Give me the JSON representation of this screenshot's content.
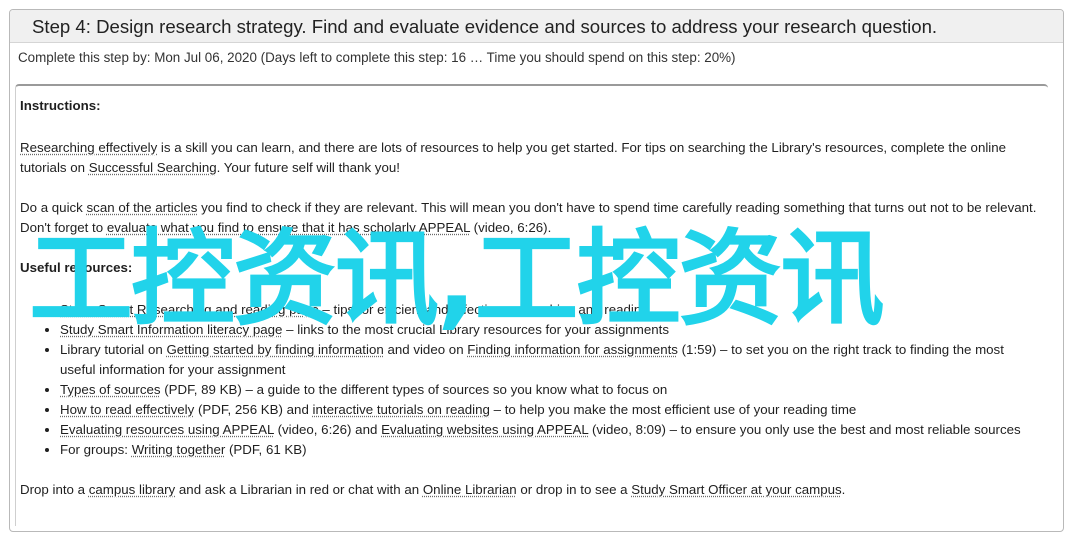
{
  "step": {
    "title": "Step 4: Design research strategy. Find and evaluate evidence and sources to address your research question.",
    "meta": "Complete this step by: Mon Jul 06, 2020 (Days left to complete this step: 16 … Time you should spend on this step: 20%)"
  },
  "instructions": {
    "heading": "Instructions:",
    "p1": {
      "link1": "Researching effectively",
      "text1": " is a skill you can learn, and there are lots of resources to help you get started. For tips on searching the Library's resources, complete the online tutorials on ",
      "link2": "Successful Searching",
      "text2": ". Your future self will thank you!"
    },
    "p2": {
      "text1": "Do a quick ",
      "link1": "scan of the articles",
      "text2": " you find to check if they are relevant. This will mean you don't have to spend time carefully reading something that turns out not to be relevant. Don't forget to ",
      "link2": "evaluate what you find to ensure that it has scholarly APPEAL",
      "text3": " (video, 6:26)."
    },
    "resources_heading": "Useful resources:",
    "resources": {
      "r1": {
        "link1": "Study Smart Researching and reading page",
        "text1": " – tips for efficient and effective researching and reading"
      },
      "r2": {
        "link1": "Study Smart Information literacy page",
        "text1": " – links to the most crucial Library resources for your assignments"
      },
      "r3": {
        "text1": "Library tutorial on ",
        "link1": "Getting started by finding information",
        "text2": " and video on ",
        "link2": "Finding information for assignments",
        "text3": " (1:59) – to set you on the right track to finding the most useful information for your assignment"
      },
      "r4": {
        "link1": "Types of sources",
        "text1": " (PDF, 89 KB) – a guide to the different types of sources so you know what to focus on"
      },
      "r5": {
        "link1": "How to read effectively",
        "text1": " (PDF, 256 KB) and ",
        "link2": "interactive tutorials on reading",
        "text2": " – to help you make the most efficient use of your reading time"
      },
      "r6": {
        "link1": "Evaluating resources using APPEAL",
        "text1": " (video, 6:26) and ",
        "link2": "Evaluating websites using APPEAL",
        "text2": " (video, 8:09) – to ensure you only use the best and most reliable sources"
      },
      "r7": {
        "text1": "For groups: ",
        "link1": "Writing together",
        "text2": " (PDF, 61 KB)"
      }
    },
    "footer": {
      "text1": "Drop into a ",
      "link1": "campus library",
      "text2": " and ask a Librarian in red or chat with an ",
      "link2": "Online Librarian",
      "text3": " or drop in to see a ",
      "link3": "Study Smart Officer at your campus",
      "text4": "."
    }
  },
  "watermark": "工控资讯,工控资讯"
}
